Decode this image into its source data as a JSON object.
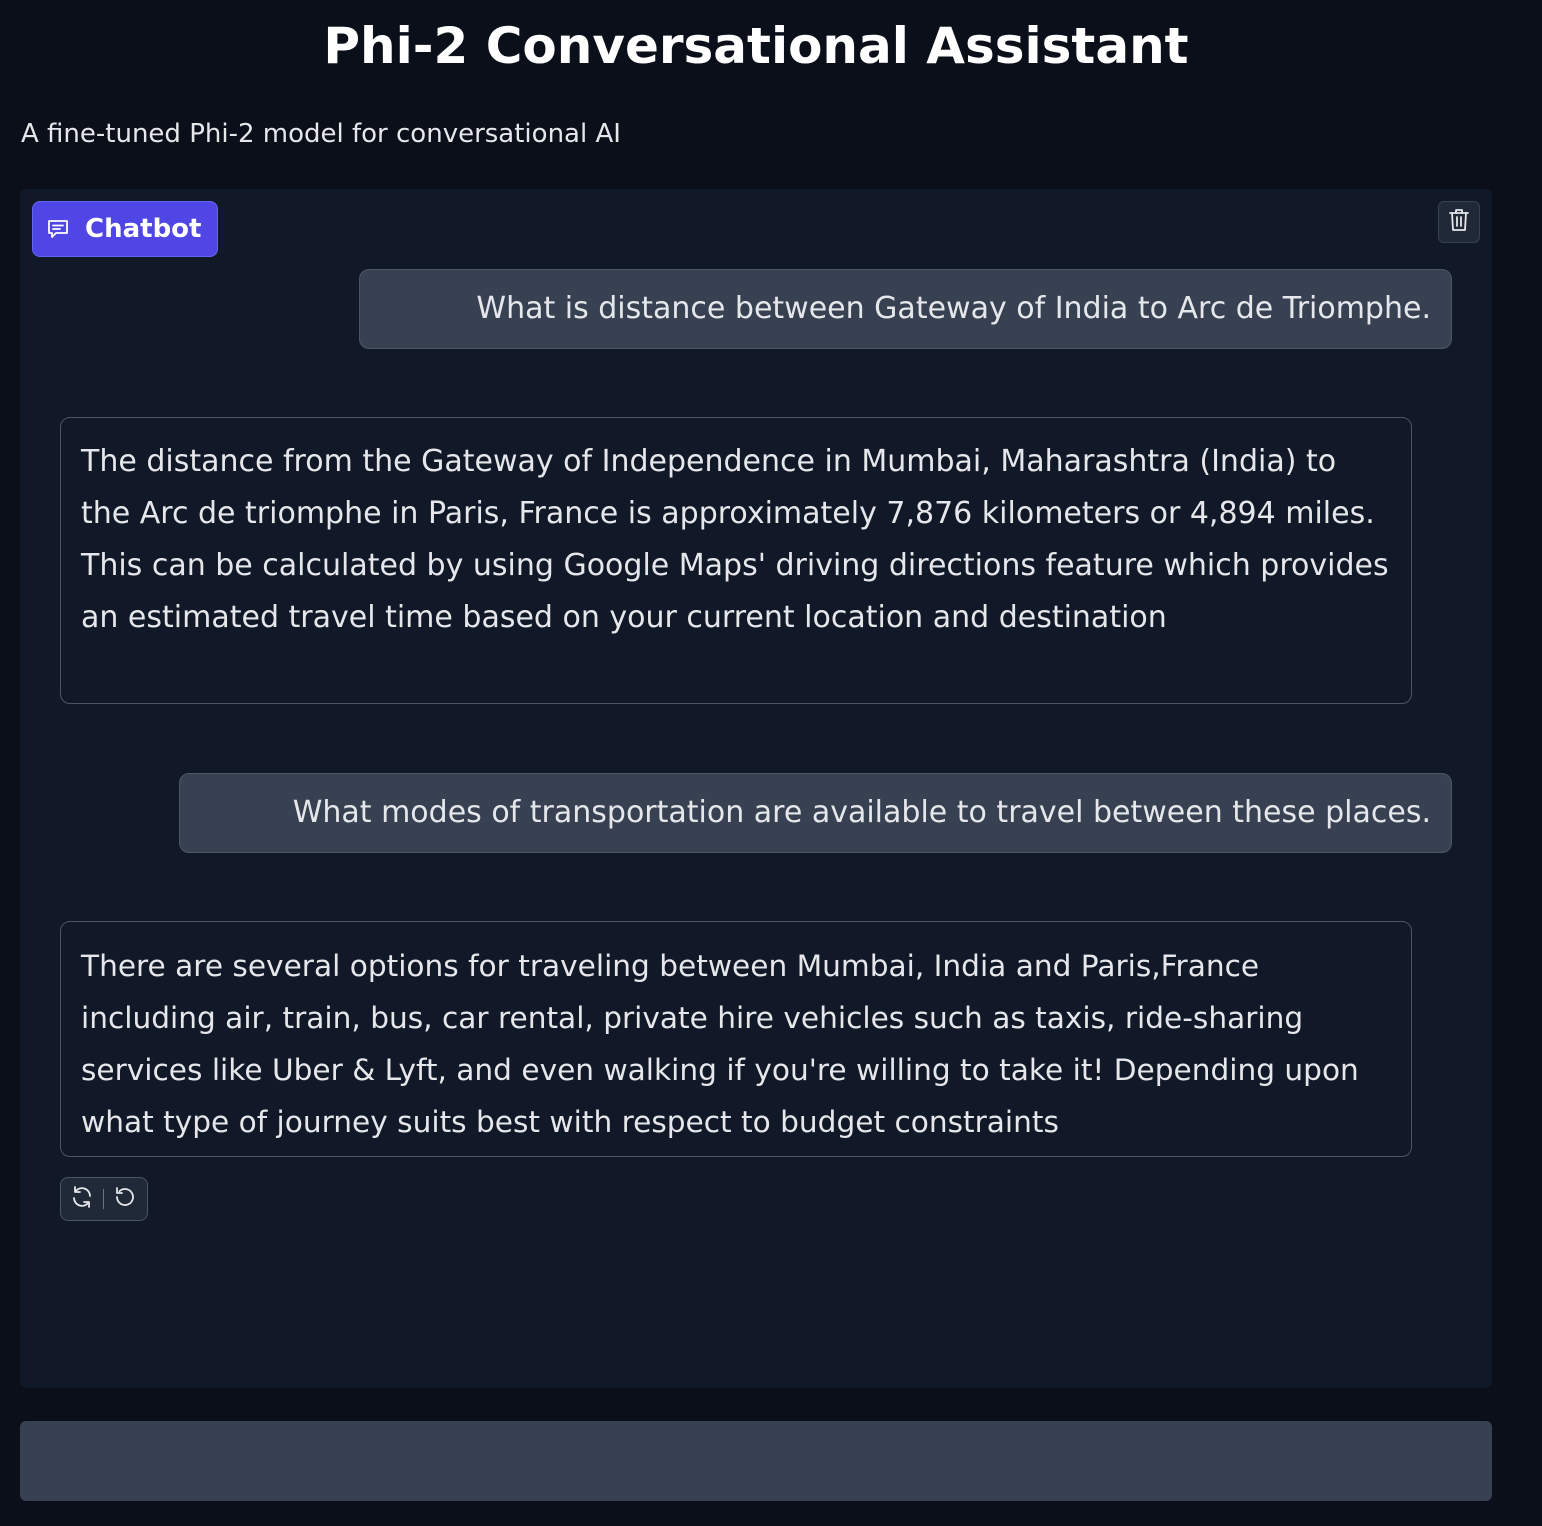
{
  "header": {
    "title": "Phi-2 Conversational Assistant",
    "description": "A fine-tuned Phi-2 model for conversational AI"
  },
  "chatbot": {
    "label": "Chatbot",
    "label_icon": "chat-icon",
    "clear_icon": "trash-icon",
    "messages": [
      {
        "role": "user",
        "text": "What is distance between Gateway of India to Arc de Triomphe."
      },
      {
        "role": "assistant",
        "text": "The distance from the Gateway of Independence in Mumbai, Maharashtra (India) to the Arc de triomphe in Paris, France is approximately 7,876 kilometers or 4,894 miles. This can be calculated by using Google Maps' driving directions feature which provides an estimated travel time based on your current location and destination"
      },
      {
        "role": "user",
        "text": "What modes of transportation are available to travel between these places."
      },
      {
        "role": "assistant",
        "text": "There are several options for traveling between Mumbai, India and Paris,France including air, train, bus, car rental, private hire vehicles such as taxis, ride-sharing services like Uber & Lyft, and even walking if you're willing to take it! Depending upon what type of journey suits best with respect to budget constraints"
      }
    ],
    "actions": {
      "retry_icon": "retry-icon",
      "undo_icon": "undo-icon"
    }
  },
  "input": {
    "value": "",
    "placeholder": ""
  },
  "colors": {
    "background": "#0b0f19",
    "panel": "#111827",
    "accent": "#4f46e5",
    "user_bubble": "#374151",
    "border": "#4b5563",
    "text": "#e5e7eb"
  }
}
